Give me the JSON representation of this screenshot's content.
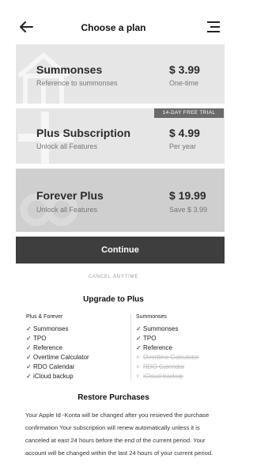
{
  "header": {
    "title": "Choose a plan",
    "back_icon": "arrow-left-icon",
    "menu_icon": "hamburger-menu-icon"
  },
  "plans": [
    {
      "name": "Summonses",
      "subtitle": "Reference to summonses",
      "price": "$ 3.99",
      "period": "One-time",
      "bg_icon": "house-icon",
      "bg_color": "#e6e6e6"
    },
    {
      "name": "Plus Subscription",
      "subtitle": "Unlock all Features",
      "price": "$ 4.99",
      "period": "Per year",
      "badge": "14-DAY FREE TRIAL",
      "bg_icon": "plus-icon",
      "bg_color": "#e6e6e6"
    },
    {
      "name": "Forever Plus",
      "subtitle": "Unlock all Features",
      "price": "$ 19.99",
      "period": "Save $ 3.99",
      "bg_icon": "infinity-icon",
      "bg_color": "#cfcfcf"
    }
  ],
  "continue_label": "Continue",
  "cancel_text": "CANCEL ANYTIME",
  "upgrade": {
    "title": "Upgrade to Plus",
    "left": {
      "heading": "Plus & Forever",
      "items": [
        {
          "mark": "✓",
          "label": "Summonses"
        },
        {
          "mark": "✓",
          "label": "TPO"
        },
        {
          "mark": "✓",
          "label": "Reference"
        },
        {
          "mark": "✓",
          "label": "Overtime Calculator"
        },
        {
          "mark": "✓",
          "label": "RDO Calendar"
        },
        {
          "mark": "✓",
          "label": "iCloud backup"
        }
      ]
    },
    "right": {
      "heading": "Summonses",
      "items": [
        {
          "mark": "✓",
          "label": "Summonses"
        },
        {
          "mark": "✓",
          "label": "TPO"
        },
        {
          "mark": "✓",
          "label": "Reference"
        },
        {
          "mark": "×",
          "label": "Overtime Calculator"
        },
        {
          "mark": "×",
          "label": "RDO Calendar"
        },
        {
          "mark": "×",
          "label": "iCloud backup"
        }
      ]
    }
  },
  "restore_label": "Restore Purchases",
  "legal": "Your Apple Id -Konta will be changed after you resieved the purchase confirmation Your subscription will renew automatically unless it is canceled at east 24 hours before the end of the current period. Your account will be changed within the last 24 hours of your current period.",
  "colors": {
    "dark_button": "#3e3e3e",
    "badge": "#6a6a6a",
    "card": "#e6e6e6",
    "card_selected": "#cfcfcf"
  }
}
